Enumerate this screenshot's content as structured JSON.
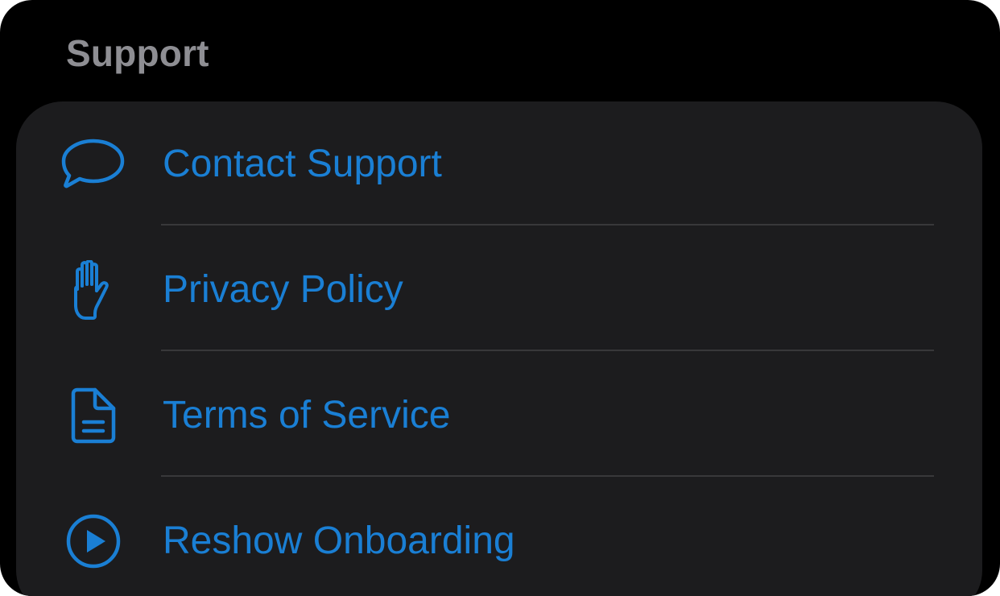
{
  "section": {
    "title": "Support"
  },
  "colors": {
    "accent": "#1a7fd4",
    "header": "#8e8e93",
    "group_background": "#1c1c1e",
    "separator": "#38383a",
    "background": "#000000"
  },
  "items": [
    {
      "label": "Contact Support",
      "icon": "speech-bubble-icon"
    },
    {
      "label": "Privacy Policy",
      "icon": "raised-hand-icon"
    },
    {
      "label": "Terms of Service",
      "icon": "document-icon"
    },
    {
      "label": "Reshow Onboarding",
      "icon": "play-circle-icon"
    }
  ]
}
